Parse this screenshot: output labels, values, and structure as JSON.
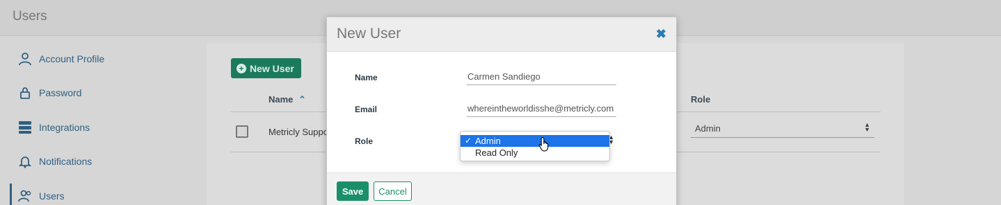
{
  "header": {
    "title": "Users"
  },
  "sidebar": {
    "items": [
      {
        "label": "Account Profile",
        "icon": "user-icon"
      },
      {
        "label": "Password",
        "icon": "lock-icon"
      },
      {
        "label": "Integrations",
        "icon": "server-icon"
      },
      {
        "label": "Notifications",
        "icon": "bell-icon"
      },
      {
        "label": "Users",
        "icon": "users-icon",
        "active": true
      }
    ]
  },
  "main": {
    "new_user_label": "New User",
    "table": {
      "columns": [
        "Name",
        "Role"
      ],
      "rows": [
        {
          "name": "Metricly Suppo",
          "role": "Admin"
        }
      ]
    }
  },
  "modal": {
    "title": "New User",
    "fields": {
      "name_label": "Name",
      "name_value": "Carmen Sandiego",
      "email_label": "Email",
      "email_value": "whereintheworldisshe@metricly.com",
      "role_label": "Role"
    },
    "role_options": [
      {
        "label": "Admin",
        "selected": true
      },
      {
        "label": "Read Only",
        "selected": false
      }
    ],
    "save_label": "Save",
    "cancel_label": "Cancel"
  },
  "colors": {
    "accent": "#1b8f6a",
    "link": "#2f5f80",
    "dropdown_highlight": "#1d73e8",
    "close": "#2a7db0"
  }
}
